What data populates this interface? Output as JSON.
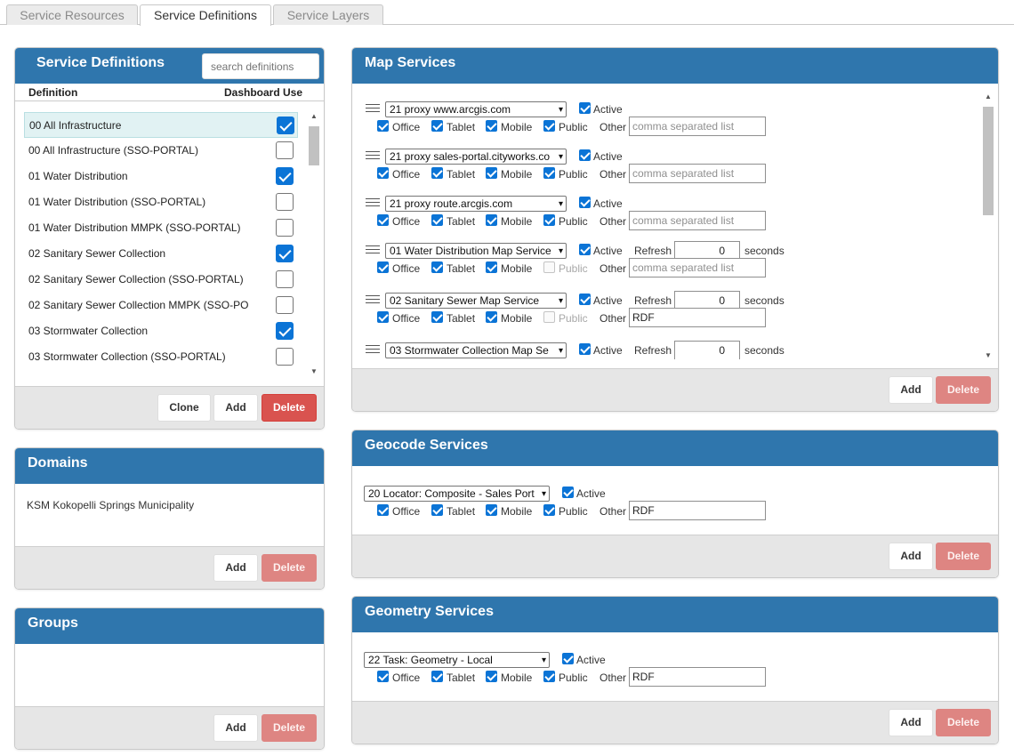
{
  "tabs": [
    "Service Resources",
    "Service Definitions",
    "Service Layers"
  ],
  "definitions_panel": {
    "title": "Service Definitions",
    "search_placeholder": "search definitions",
    "col_definition": "Definition",
    "col_dashboard": "Dashboard Use",
    "rows": [
      {
        "name": "00 All Infrastructure",
        "checked": true,
        "selected": true
      },
      {
        "name": "00 All Infrastructure (SSO-PORTAL)",
        "checked": false
      },
      {
        "name": "01 Water Distribution",
        "checked": true
      },
      {
        "name": "01 Water Distribution (SSO-PORTAL)",
        "checked": false
      },
      {
        "name": "01 Water Distribution MMPK (SSO-PORTAL)",
        "checked": false
      },
      {
        "name": "02 Sanitary Sewer Collection",
        "checked": true
      },
      {
        "name": "02 Sanitary Sewer Collection (SSO-PORTAL)",
        "checked": false
      },
      {
        "name": "02 Sanitary Sewer Collection MMPK (SSO-PO",
        "checked": false
      },
      {
        "name": "03 Stormwater Collection",
        "checked": true
      },
      {
        "name": "03 Stormwater Collection (SSO-PORTAL)",
        "checked": false
      }
    ],
    "clone": "Clone",
    "add": "Add",
    "delete": "Delete"
  },
  "domains_panel": {
    "title": "Domains",
    "items": [
      "KSM Kokopelli Springs Municipality"
    ],
    "add": "Add",
    "delete": "Delete"
  },
  "groups_panel": {
    "title": "Groups",
    "add": "Add",
    "delete": "Delete"
  },
  "labels": {
    "active": "Active",
    "office": "Office",
    "tablet": "Tablet",
    "mobile": "Mobile",
    "public": "Public",
    "other": "Other",
    "refresh": "Refresh",
    "seconds": "seconds",
    "other_placeholder": "comma separated list"
  },
  "map_services": {
    "title": "Map Services",
    "rows": [
      {
        "service": "21 proxy www.arcgis.com",
        "refresh": null,
        "public_enabled": true,
        "other": ""
      },
      {
        "service": "21 proxy sales-portal.cityworks.co",
        "refresh": null,
        "public_enabled": true,
        "other": ""
      },
      {
        "service": "21 proxy route.arcgis.com",
        "refresh": null,
        "public_enabled": true,
        "other": ""
      },
      {
        "service": "01 Water Distribution Map Service",
        "refresh": "0",
        "public_enabled": false,
        "other": ""
      },
      {
        "service": "02 Sanitary Sewer Map Service",
        "refresh": "0",
        "public_enabled": false,
        "other": "RDF"
      },
      {
        "service": "03 Stormwater Collection Map Se",
        "refresh": "0",
        "public_enabled": null,
        "other": null
      }
    ],
    "add": "Add",
    "delete": "Delete"
  },
  "geocode_services": {
    "title": "Geocode Services",
    "service": "20 Locator: Composite - Sales Port",
    "other": "RDF",
    "add": "Add",
    "delete": "Delete"
  },
  "geometry_services": {
    "title": "Geometry Services",
    "service": "22 Task: Geometry - Local",
    "other": "RDF",
    "add": "Add",
    "delete": "Delete"
  },
  "colors": {
    "header": "#2f76ad",
    "delete": "#d9534f",
    "delete_disabled": "#de8582",
    "check": "#0b74d6",
    "selected_row": "#e1f2f3"
  }
}
